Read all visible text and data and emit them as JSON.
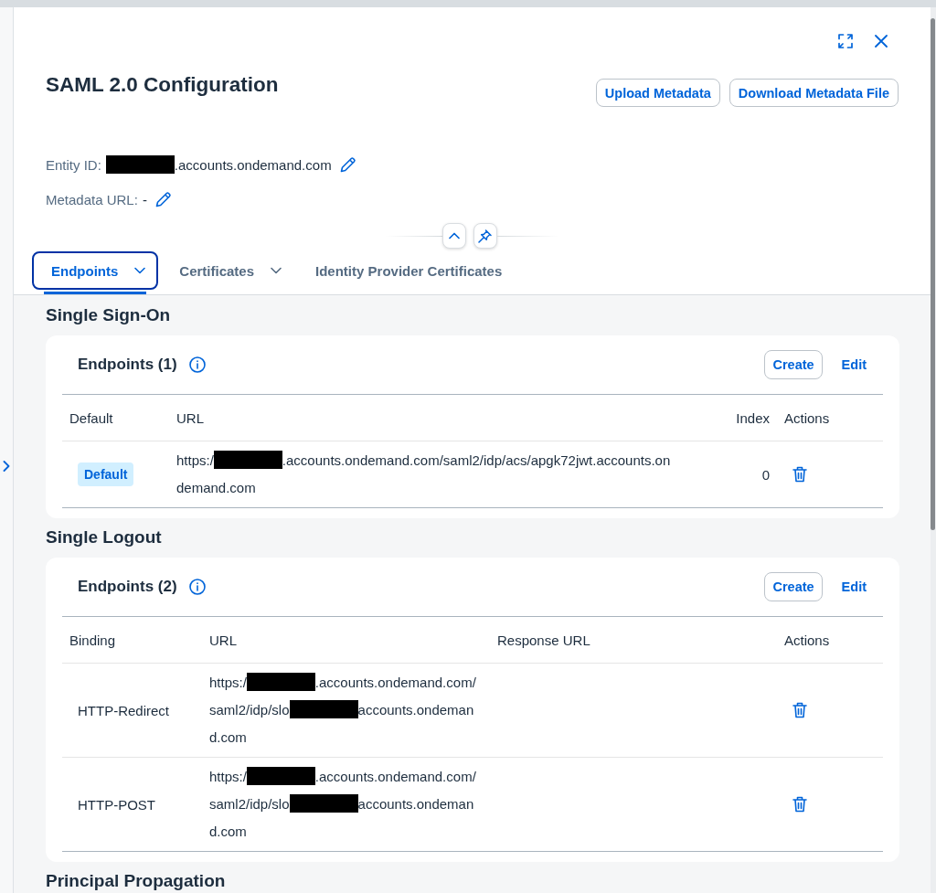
{
  "window": {
    "title": "SAML 2.0 Configuration"
  },
  "header_buttons": [
    "Upload Metadata",
    "Download Metadata File"
  ],
  "fields": [
    {
      "label": "Entity ID:",
      "value": [
        {
          "kind": "redacted"
        },
        {
          "kind": "text",
          "text": ".accounts.ondemand.com"
        }
      ]
    },
    {
      "label": "Metadata URL:",
      "value": [
        {
          "kind": "text",
          "text": "-"
        }
      ]
    }
  ],
  "tabs": [
    {
      "label": "Endpoints",
      "selected": true,
      "focused": true,
      "has_menu": true
    },
    {
      "label": "Certificates",
      "selected": false,
      "focused": false,
      "has_menu": true
    },
    {
      "label": "Identity Provider Certificates",
      "selected": false,
      "focused": false,
      "has_menu": false
    }
  ],
  "sections": [
    {
      "title": "Single Sign-On",
      "table": {
        "title": "Endpoints (1)",
        "actions": [
          {
            "label": "Create",
            "kind": "outlined"
          },
          {
            "label": "Edit",
            "kind": "transparent"
          }
        ],
        "columns": [
          {
            "label": "Default",
            "kind": "badge"
          },
          {
            "label": "URL",
            "kind": "url"
          },
          {
            "label": "Index",
            "kind": "index"
          },
          {
            "label": "Actions",
            "kind": "actions"
          }
        ],
        "rows": [
          {
            "badge": "Default",
            "url": [
              {
                "kind": "text",
                "text": "https:/"
              },
              {
                "kind": "redacted"
              },
              {
                "kind": "text",
                "text": ".accounts.ondemand.com/saml2/idp/acs/apgk72jwt.accounts.ondemand.com"
              }
            ],
            "index": "0"
          }
        ]
      }
    },
    {
      "title": "Single Logout",
      "table": {
        "title": "Endpoints (2)",
        "actions": [
          {
            "label": "Create",
            "kind": "outlined"
          },
          {
            "label": "Edit",
            "kind": "transparent"
          }
        ],
        "columns": [
          {
            "label": "Binding",
            "kind": "binding"
          },
          {
            "label": "URL",
            "kind": "url"
          },
          {
            "label": "Response URL",
            "kind": "response_url"
          },
          {
            "label": "Actions",
            "kind": "actions"
          }
        ],
        "rows": [
          {
            "binding": "HTTP-Redirect",
            "url": [
              {
                "kind": "text",
                "text": "https:/"
              },
              {
                "kind": "redacted"
              },
              {
                "kind": "text",
                "text": ".accounts.ondemand.com/saml2/idp/slo"
              },
              {
                "kind": "redacted"
              },
              {
                "kind": "text",
                "text": "accounts.ondemand.com"
              }
            ]
          },
          {
            "binding": "HTTP-POST",
            "url": [
              {
                "kind": "text",
                "text": "https:/"
              },
              {
                "kind": "redacted"
              },
              {
                "kind": "text",
                "text": ".accounts.ondemand.com/saml2/idp/slo"
              },
              {
                "kind": "redacted"
              },
              {
                "kind": "text",
                "text": "accounts.ondemand.com"
              }
            ]
          }
        ]
      }
    },
    {
      "title": "Principal Propagation"
    }
  ]
}
